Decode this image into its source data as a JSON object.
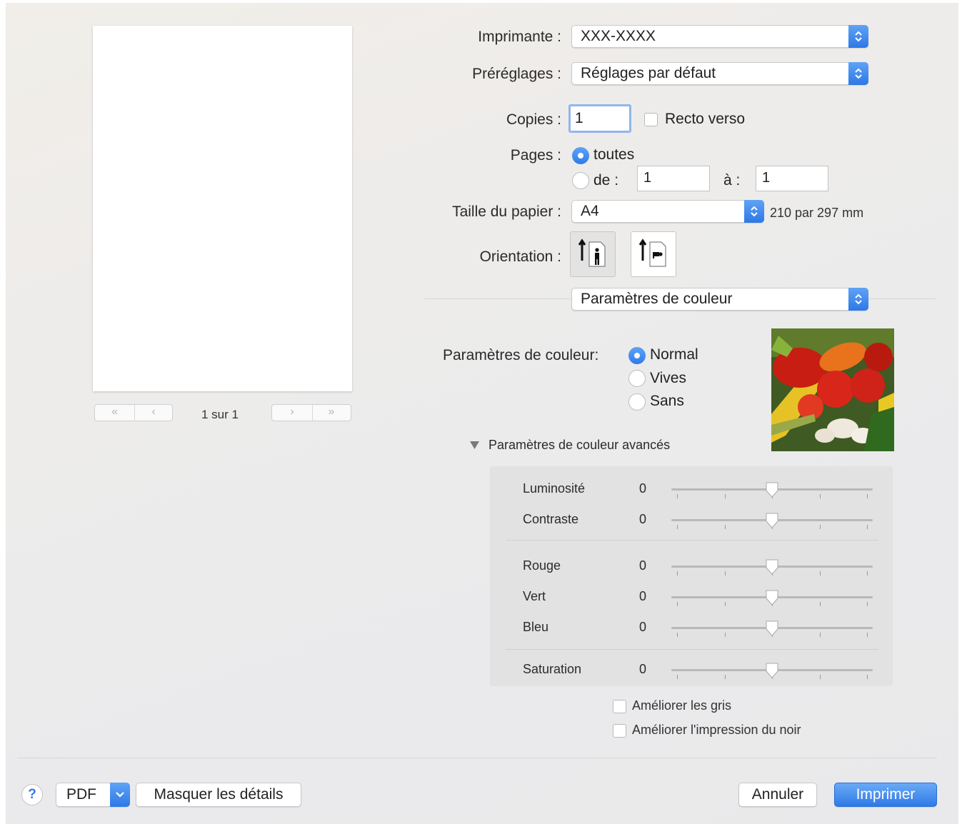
{
  "printer": {
    "label": "Imprimante :",
    "value": "XXX-XXXX"
  },
  "presets": {
    "label": "Préréglages :",
    "value": "Réglages par défaut"
  },
  "copies": {
    "label": "Copies :",
    "value": "1",
    "duplex_label": "Recto verso"
  },
  "pages": {
    "label": "Pages :",
    "all_label": "toutes",
    "from_label": "de :",
    "from_value": "1",
    "to_label": "à :",
    "to_value": "1"
  },
  "paper": {
    "label": "Taille du papier :",
    "value": "A4",
    "dimensions": "210 par 297 mm"
  },
  "orientation": {
    "label": "Orientation :"
  },
  "section_popup": {
    "value": "Paramètres de couleur"
  },
  "color": {
    "label": "Paramètres de couleur:",
    "options": [
      "Normal",
      "Vives",
      "Sans"
    ],
    "selected": "Normal",
    "advanced_label": "Paramètres de couleur avancés"
  },
  "sliders": [
    {
      "label": "Luminosité",
      "value": "0"
    },
    {
      "label": "Contraste",
      "value": "0"
    },
    {
      "label": "Rouge",
      "value": "0"
    },
    {
      "label": "Vert",
      "value": "0"
    },
    {
      "label": "Bleu",
      "value": "0"
    },
    {
      "label": "Saturation",
      "value": "0"
    }
  ],
  "checkboxes": {
    "improve_gray": "Améliorer les gris",
    "improve_black": "Améliorer l'impression du noir"
  },
  "preview": {
    "page_counter": "1 sur 1"
  },
  "footer": {
    "help": "?",
    "pdf": "PDF",
    "hide_details": "Masquer les détails",
    "cancel": "Annuler",
    "print": "Imprimer"
  },
  "colors": {
    "accent": "#2d78e6",
    "window_bg": "#ececec"
  }
}
